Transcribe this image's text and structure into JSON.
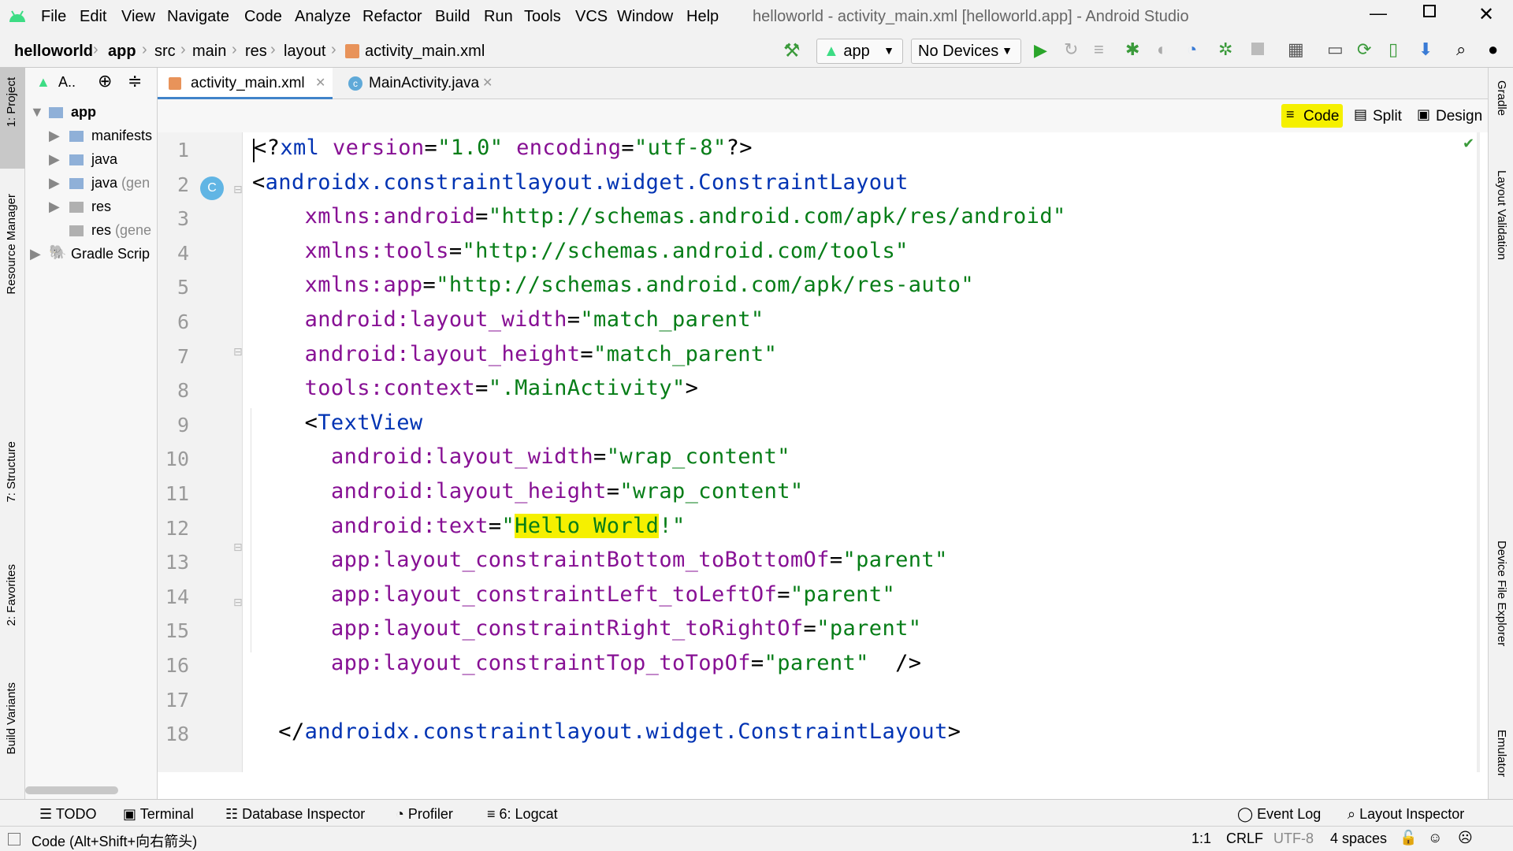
{
  "window": {
    "title": "helloworld - activity_main.xml [helloworld.app] - Android Studio"
  },
  "menu": [
    "File",
    "Edit",
    "View",
    "Navigate",
    "Code",
    "Analyze",
    "Refactor",
    "Build",
    "Run",
    "Tools",
    "VCS",
    "Window",
    "Help"
  ],
  "breadcrumb": [
    "helloworld",
    "app",
    "src",
    "main",
    "res",
    "layout",
    "activity_main.xml"
  ],
  "toolbar": {
    "config": "app",
    "device": "No Devices"
  },
  "left_tabs": [
    "1: Project",
    "Resource Manager",
    "7: Structure",
    "2: Favorites",
    "Build Variants"
  ],
  "right_tabs": [
    "Gradle",
    "Layout Validation",
    "Device File Explorer",
    "Emulator"
  ],
  "project": {
    "view_label": "A..",
    "items": [
      {
        "label": "app",
        "bold": true
      },
      {
        "label": "manifests"
      },
      {
        "label": "java"
      },
      {
        "label": "java",
        "suffix": "(gen"
      },
      {
        "label": "res"
      },
      {
        "label": "res",
        "suffix": "(gene"
      },
      {
        "label": "Gradle Scrip"
      }
    ]
  },
  "tabs": [
    {
      "label": "activity_main.xml"
    },
    {
      "label": "MainActivity.java"
    }
  ],
  "view_modes": [
    "Code",
    "Split",
    "Design"
  ],
  "code_lines": [
    [
      [
        "pun",
        "<?"
      ],
      [
        "tag",
        "xml "
      ],
      [
        "attr",
        "version"
      ],
      [
        "pun",
        "="
      ],
      [
        "val",
        "\"1.0\""
      ],
      [
        "pun",
        " "
      ],
      [
        "attr",
        "encoding"
      ],
      [
        "pun",
        "="
      ],
      [
        "val",
        "\"utf-8\""
      ],
      [
        "pun",
        "?>"
      ]
    ],
    [
      [
        "pun",
        "<"
      ],
      [
        "tag",
        "androidx.constraintlayout.widget.ConstraintLayout"
      ]
    ],
    [
      [
        "pun",
        "    "
      ],
      [
        "attr",
        "xmlns:android"
      ],
      [
        "pun",
        "="
      ],
      [
        "val",
        "\"http://schemas.android.com/apk/res/android\""
      ]
    ],
    [
      [
        "pun",
        "    "
      ],
      [
        "attr",
        "xmlns:tools"
      ],
      [
        "pun",
        "="
      ],
      [
        "val",
        "\"http://schemas.android.com/tools\""
      ]
    ],
    [
      [
        "pun",
        "    "
      ],
      [
        "attr",
        "xmlns:app"
      ],
      [
        "pun",
        "="
      ],
      [
        "val",
        "\"http://schemas.android.com/apk/res-auto\""
      ]
    ],
    [
      [
        "pun",
        "    "
      ],
      [
        "attr",
        "android:layout_width"
      ],
      [
        "pun",
        "="
      ],
      [
        "val",
        "\"match_parent\""
      ]
    ],
    [
      [
        "pun",
        "    "
      ],
      [
        "attr",
        "android:layout_height"
      ],
      [
        "pun",
        "="
      ],
      [
        "val",
        "\"match_parent\""
      ]
    ],
    [
      [
        "pun",
        "    "
      ],
      [
        "attr",
        "tools:context"
      ],
      [
        "pun",
        "="
      ],
      [
        "val",
        "\".MainActivity\""
      ],
      [
        "pun",
        ">"
      ]
    ],
    [
      [
        "pun",
        "    <"
      ],
      [
        "tag",
        "TextView"
      ]
    ],
    [
      [
        "pun",
        "      "
      ],
      [
        "attr",
        "android:layout_width"
      ],
      [
        "pun",
        "="
      ],
      [
        "val",
        "\"wrap_content\""
      ]
    ],
    [
      [
        "pun",
        "      "
      ],
      [
        "attr",
        "android:layout_height"
      ],
      [
        "pun",
        "="
      ],
      [
        "val",
        "\"wrap_content\""
      ]
    ],
    [
      [
        "pun",
        "      "
      ],
      [
        "attr",
        "android:text"
      ],
      [
        "pun",
        "="
      ],
      [
        "val",
        "\""
      ],
      [
        "valhl",
        "Hello World"
      ],
      [
        "val",
        "!\""
      ]
    ],
    [
      [
        "pun",
        "      "
      ],
      [
        "attr",
        "app:layout_constraintBottom_toBottomOf"
      ],
      [
        "pun",
        "="
      ],
      [
        "val",
        "\"parent\""
      ]
    ],
    [
      [
        "pun",
        "      "
      ],
      [
        "attr",
        "app:layout_constraintLeft_toLeftOf"
      ],
      [
        "pun",
        "="
      ],
      [
        "val",
        "\"parent\""
      ]
    ],
    [
      [
        "pun",
        "      "
      ],
      [
        "attr",
        "app:layout_constraintRight_toRightOf"
      ],
      [
        "pun",
        "="
      ],
      [
        "val",
        "\"parent\""
      ]
    ],
    [
      [
        "pun",
        "      "
      ],
      [
        "attr",
        "app:layout_constraintTop_toTopOf"
      ],
      [
        "pun",
        "="
      ],
      [
        "val",
        "\"parent\""
      ],
      [
        "pun",
        "  />"
      ]
    ],
    [],
    [
      [
        "pun",
        "  </"
      ],
      [
        "tag",
        "androidx.constraintlayout.widget.ConstraintLayout"
      ],
      [
        "pun",
        ">"
      ]
    ]
  ],
  "bottom_tools": [
    "TODO",
    "Terminal",
    "Database Inspector",
    "Profiler",
    "6: Logcat"
  ],
  "bottom_tools_right": [
    "Event Log",
    "Layout Inspector"
  ],
  "status": {
    "hint": "Code (Alt+Shift+向右箭头)",
    "pos": "1:1",
    "eol": "CRLF",
    "enc": "UTF-8",
    "indent": "4 spaces"
  }
}
